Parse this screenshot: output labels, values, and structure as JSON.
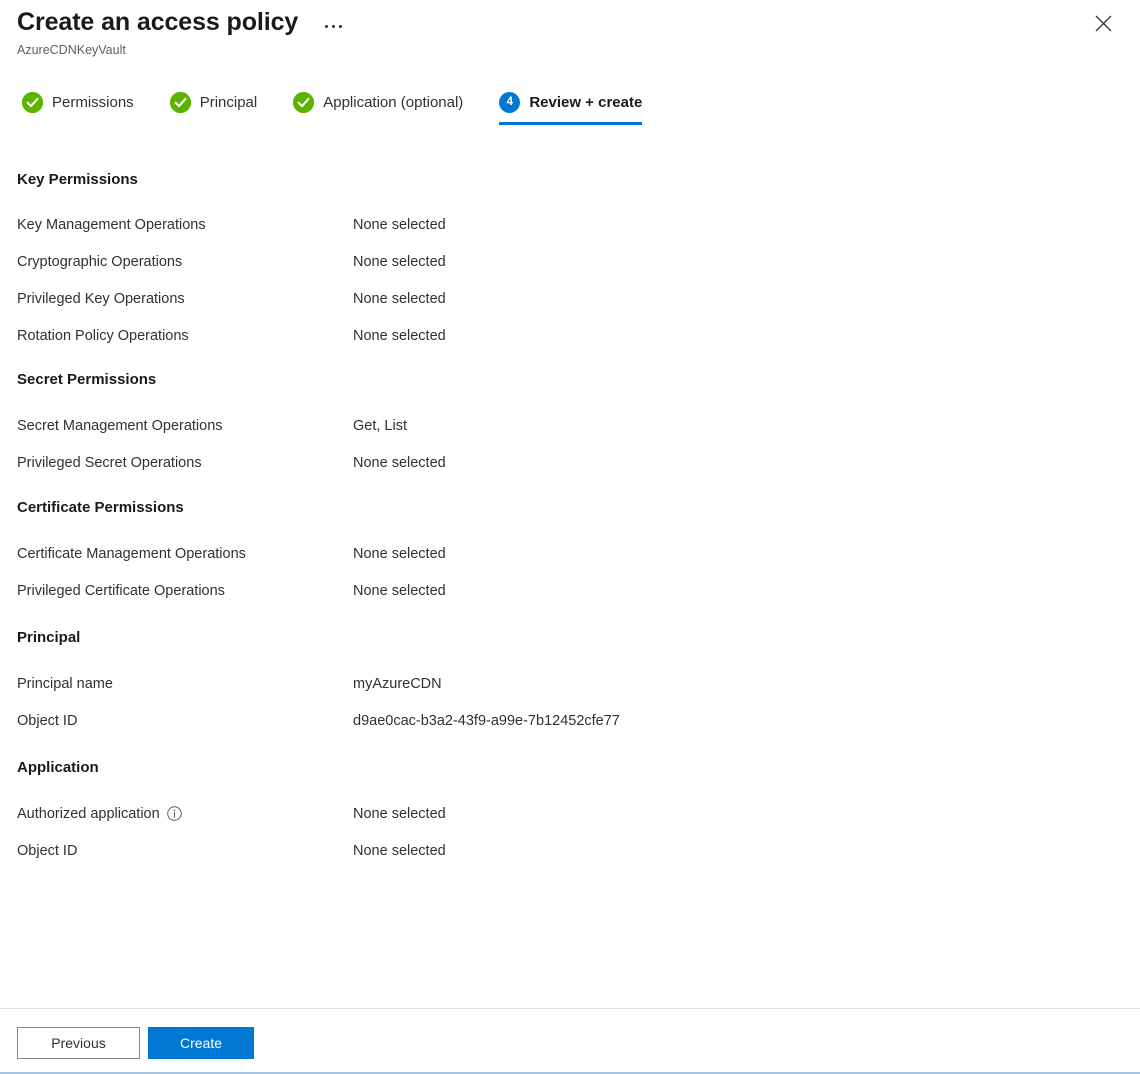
{
  "header": {
    "title": "Create an access policy",
    "subtitle": "AzureCDNKeyVault",
    "more_menu_label": "More",
    "close_label": "Close"
  },
  "tabs": [
    {
      "label": "Permissions",
      "state": "done",
      "badge": ""
    },
    {
      "label": "Principal",
      "state": "done",
      "badge": ""
    },
    {
      "label": "Application (optional)",
      "state": "done",
      "badge": ""
    },
    {
      "label": "Review + create",
      "state": "active",
      "badge": "4"
    }
  ],
  "sections": [
    {
      "heading": "Key Permissions",
      "rows": [
        {
          "label": "Key Management Operations",
          "value": "None selected"
        },
        {
          "label": "Cryptographic Operations",
          "value": "None selected"
        },
        {
          "label": "Privileged Key Operations",
          "value": "None selected"
        },
        {
          "label": "Rotation Policy Operations",
          "value": "None selected"
        }
      ]
    },
    {
      "heading": "Secret Permissions",
      "rows": [
        {
          "label": "Secret Management Operations",
          "value": "Get, List"
        },
        {
          "label": "Privileged Secret Operations",
          "value": "None selected"
        }
      ]
    },
    {
      "heading": "Certificate Permissions",
      "rows": [
        {
          "label": "Certificate Management Operations",
          "value": "None selected"
        },
        {
          "label": "Privileged Certificate Operations",
          "value": "None selected"
        }
      ]
    },
    {
      "heading": "Principal",
      "rows": [
        {
          "label": "Principal name",
          "value": "myAzureCDN"
        },
        {
          "label": "Object ID",
          "value": "d9ae0cac-b3a2-43f9-a99e-7b12452cfe77"
        }
      ]
    },
    {
      "heading": "Application",
      "rows": [
        {
          "label": "Authorized application",
          "value": "None selected",
          "info": true
        },
        {
          "label": "Object ID",
          "value": "None selected"
        }
      ]
    }
  ],
  "footer": {
    "previous_label": "Previous",
    "create_label": "Create"
  },
  "colors": {
    "accent": "#0078d4",
    "success": "#5cb300",
    "text": "#323130",
    "text_strong": "#1b1a19",
    "text_muted": "#605e5c",
    "divider": "#e1dfdd"
  }
}
